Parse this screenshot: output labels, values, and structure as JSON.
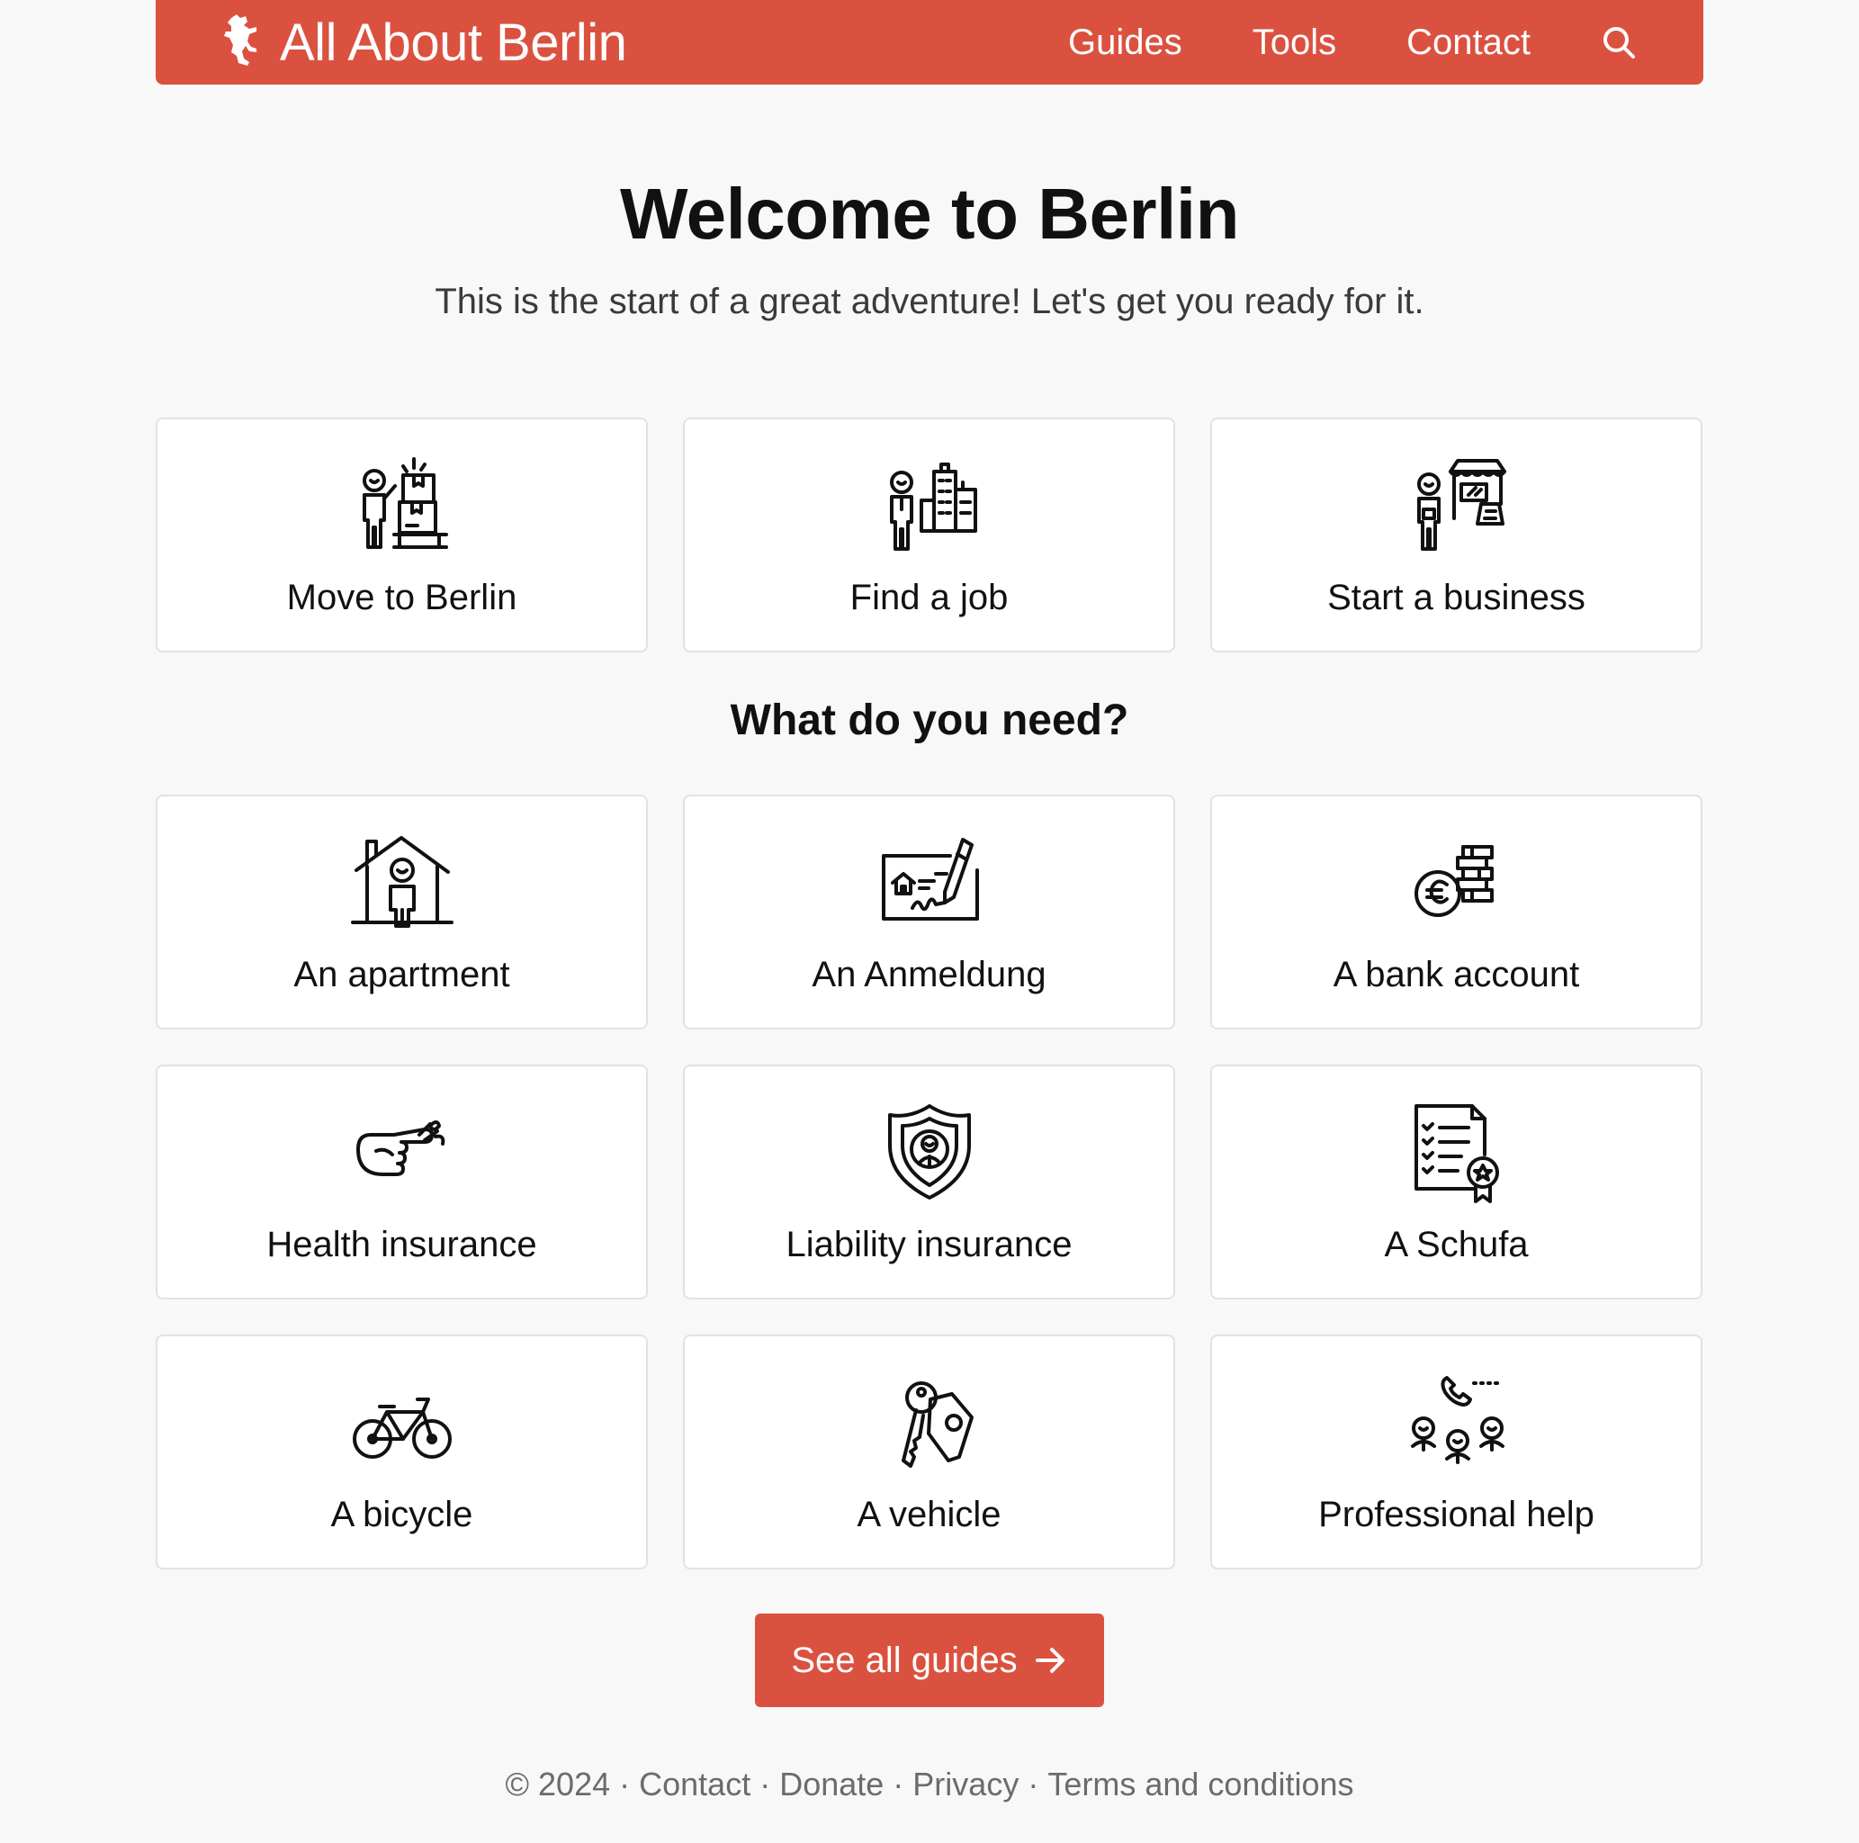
{
  "header": {
    "logo_text": "All About Berlin",
    "brand_color": "#db5140",
    "logo_icon": "berlin-bear-icon",
    "nav": [
      {
        "label": "Guides"
      },
      {
        "label": "Tools"
      },
      {
        "label": "Contact"
      }
    ],
    "search_icon": "search-icon"
  },
  "hero": {
    "title": "Welcome to Berlin",
    "subtitle": "This is the start of a great adventure! Let's get you ready for it."
  },
  "top_cards": [
    {
      "label": "Move to Berlin",
      "icon": "moving-boxes-icon"
    },
    {
      "label": "Find a job",
      "icon": "job-city-icon"
    },
    {
      "label": "Start a business",
      "icon": "shop-business-icon"
    }
  ],
  "section_title": "What do you need?",
  "cards": [
    {
      "label": "An apartment",
      "icon": "apartment-house-icon"
    },
    {
      "label": "An Anmeldung",
      "icon": "registration-document-icon"
    },
    {
      "label": "A bank account",
      "icon": "euro-coins-icon"
    },
    {
      "label": "Health insurance",
      "icon": "bandaged-hand-icon"
    },
    {
      "label": "Liability insurance",
      "icon": "shield-person-icon"
    },
    {
      "label": "A Schufa",
      "icon": "checklist-certificate-icon"
    },
    {
      "label": "A bicycle",
      "icon": "bicycle-icon"
    },
    {
      "label": "A vehicle",
      "icon": "car-keys-icon"
    },
    {
      "label": "Professional help",
      "icon": "professionals-phone-icon"
    }
  ],
  "cta": {
    "label": "See all guides",
    "icon": "arrow-right-icon"
  },
  "footer": {
    "copyright": "© 2024",
    "links": [
      {
        "label": "Contact"
      },
      {
        "label": "Donate"
      },
      {
        "label": "Privacy"
      },
      {
        "label": "Terms and conditions"
      }
    ]
  }
}
